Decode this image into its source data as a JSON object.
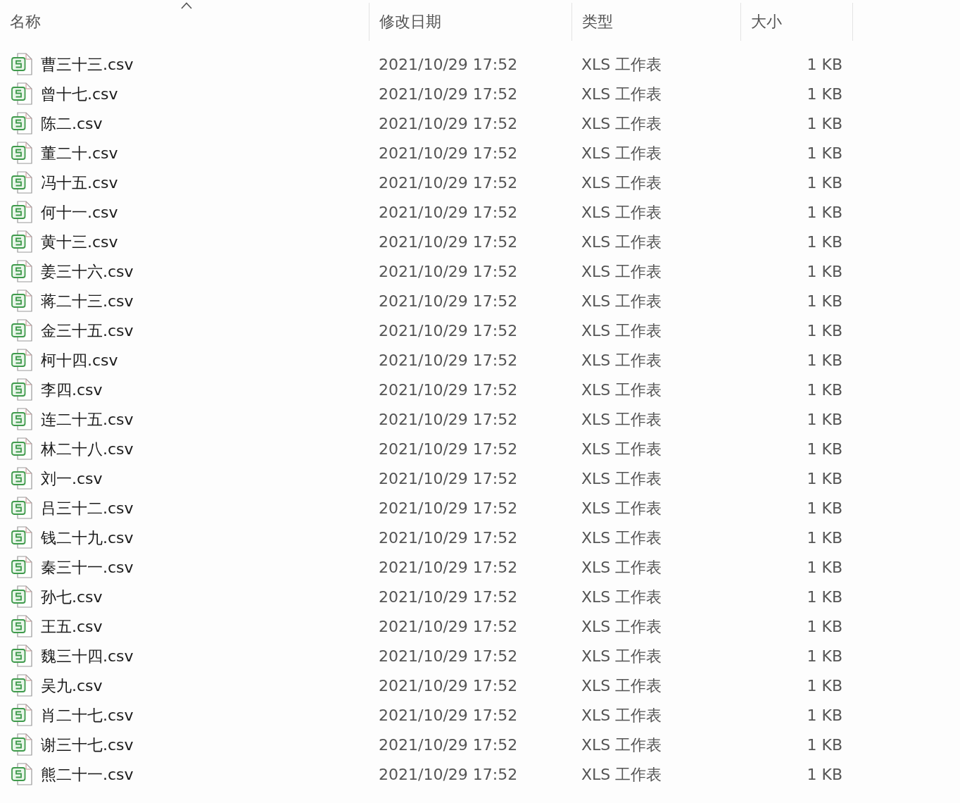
{
  "columns": [
    {
      "label": "名称",
      "sorted": true
    },
    {
      "label": "修改日期",
      "sorted": false
    },
    {
      "label": "类型",
      "sorted": false
    },
    {
      "label": "大小",
      "sorted": false
    }
  ],
  "rows": [
    {
      "name": "曹三十三.csv",
      "modified": "2021/10/29 17:52",
      "type": "XLS 工作表",
      "size": "1 KB"
    },
    {
      "name": "曾十七.csv",
      "modified": "2021/10/29 17:52",
      "type": "XLS 工作表",
      "size": "1 KB"
    },
    {
      "name": "陈二.csv",
      "modified": "2021/10/29 17:52",
      "type": "XLS 工作表",
      "size": "1 KB"
    },
    {
      "name": "董二十.csv",
      "modified": "2021/10/29 17:52",
      "type": "XLS 工作表",
      "size": "1 KB"
    },
    {
      "name": "冯十五.csv",
      "modified": "2021/10/29 17:52",
      "type": "XLS 工作表",
      "size": "1 KB"
    },
    {
      "name": "何十一.csv",
      "modified": "2021/10/29 17:52",
      "type": "XLS 工作表",
      "size": "1 KB"
    },
    {
      "name": "黄十三.csv",
      "modified": "2021/10/29 17:52",
      "type": "XLS 工作表",
      "size": "1 KB"
    },
    {
      "name": "姜三十六.csv",
      "modified": "2021/10/29 17:52",
      "type": "XLS 工作表",
      "size": "1 KB"
    },
    {
      "name": "蒋二十三.csv",
      "modified": "2021/10/29 17:52",
      "type": "XLS 工作表",
      "size": "1 KB"
    },
    {
      "name": "金三十五.csv",
      "modified": "2021/10/29 17:52",
      "type": "XLS 工作表",
      "size": "1 KB"
    },
    {
      "name": "柯十四.csv",
      "modified": "2021/10/29 17:52",
      "type": "XLS 工作表",
      "size": "1 KB"
    },
    {
      "name": "李四.csv",
      "modified": "2021/10/29 17:52",
      "type": "XLS 工作表",
      "size": "1 KB"
    },
    {
      "name": "连二十五.csv",
      "modified": "2021/10/29 17:52",
      "type": "XLS 工作表",
      "size": "1 KB"
    },
    {
      "name": "林二十八.csv",
      "modified": "2021/10/29 17:52",
      "type": "XLS 工作表",
      "size": "1 KB"
    },
    {
      "name": "刘一.csv",
      "modified": "2021/10/29 17:52",
      "type": "XLS 工作表",
      "size": "1 KB"
    },
    {
      "name": "吕三十二.csv",
      "modified": "2021/10/29 17:52",
      "type": "XLS 工作表",
      "size": "1 KB"
    },
    {
      "name": "钱二十九.csv",
      "modified": "2021/10/29 17:52",
      "type": "XLS 工作表",
      "size": "1 KB"
    },
    {
      "name": "秦三十一.csv",
      "modified": "2021/10/29 17:52",
      "type": "XLS 工作表",
      "size": "1 KB"
    },
    {
      "name": "孙七.csv",
      "modified": "2021/10/29 17:52",
      "type": "XLS 工作表",
      "size": "1 KB"
    },
    {
      "name": "王五.csv",
      "modified": "2021/10/29 17:52",
      "type": "XLS 工作表",
      "size": "1 KB"
    },
    {
      "name": "魏三十四.csv",
      "modified": "2021/10/29 17:52",
      "type": "XLS 工作表",
      "size": "1 KB"
    },
    {
      "name": "吴九.csv",
      "modified": "2021/10/29 17:52",
      "type": "XLS 工作表",
      "size": "1 KB"
    },
    {
      "name": "肖二十七.csv",
      "modified": "2021/10/29 17:52",
      "type": "XLS 工作表",
      "size": "1 KB"
    },
    {
      "name": "谢三十七.csv",
      "modified": "2021/10/29 17:52",
      "type": "XLS 工作表",
      "size": "1 KB"
    },
    {
      "name": "熊二十一.csv",
      "modified": "2021/10/29 17:52",
      "type": "XLS 工作表",
      "size": "1 KB"
    }
  ]
}
